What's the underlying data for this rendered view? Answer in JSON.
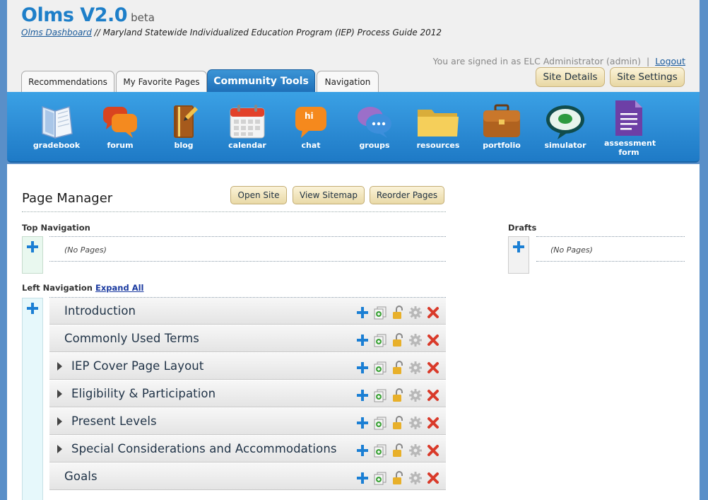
{
  "app": {
    "title": "Olms V2.0",
    "badge": "beta",
    "breadcrumb_link": "Olms Dashboard",
    "breadcrumb_rest": " // Maryland Statewide Individualized Education Program (IEP) Process Guide 2012"
  },
  "account": {
    "signed_in": "You are signed in as ELC Administrator (admin)",
    "separator": "|",
    "logout": "Logout"
  },
  "header_buttons": {
    "site_details": "Site Details",
    "site_settings": "Site Settings"
  },
  "tabs": [
    {
      "label": "Recommendations"
    },
    {
      "label": "My Favorite Pages"
    },
    {
      "label": "Community Tools",
      "active": true
    },
    {
      "label": "Navigation"
    }
  ],
  "tools": [
    {
      "label": "gradebook",
      "icon": "gradebook-icon"
    },
    {
      "label": "forum",
      "icon": "forum-icon"
    },
    {
      "label": "blog",
      "icon": "blog-icon"
    },
    {
      "label": "calendar",
      "icon": "calendar-icon"
    },
    {
      "label": "chat",
      "icon": "chat-icon",
      "glyph": "hi"
    },
    {
      "label": "groups",
      "icon": "groups-icon"
    },
    {
      "label": "resources",
      "icon": "folder-icon"
    },
    {
      "label": "portfolio",
      "icon": "briefcase-icon"
    },
    {
      "label": "simulator",
      "icon": "simulator-icon"
    },
    {
      "label": "assessment form",
      "icon": "document-icon"
    }
  ],
  "page_manager": {
    "title": "Page Manager",
    "buttons": {
      "open_site": "Open Site",
      "view_sitemap": "View Sitemap",
      "reorder_pages": "Reorder Pages"
    },
    "top_navigation": {
      "heading": "Top Navigation",
      "empty": "(No Pages)"
    },
    "drafts": {
      "heading": "Drafts",
      "empty": "(No Pages)"
    },
    "left_navigation": {
      "heading": "Left Navigation",
      "expand_all": "Expand All",
      "pages": [
        {
          "label": "Introduction",
          "expandable": false
        },
        {
          "label": "Commonly Used Terms",
          "expandable": false
        },
        {
          "label": "IEP Cover Page Layout",
          "expandable": true
        },
        {
          "label": "Eligibility & Participation",
          "expandable": true
        },
        {
          "label": "Present Levels",
          "expandable": true
        },
        {
          "label": "Special Considerations and Accommodations",
          "expandable": true
        },
        {
          "label": "Goals",
          "expandable": false
        }
      ]
    }
  },
  "colors": {
    "brand_blue": "#1e7fc9",
    "toolbar_blue": "#2f8fd7",
    "button_gold": "#e8d7a3",
    "delete_red": "#d93a2a",
    "add_blue": "#1b7fd4"
  }
}
